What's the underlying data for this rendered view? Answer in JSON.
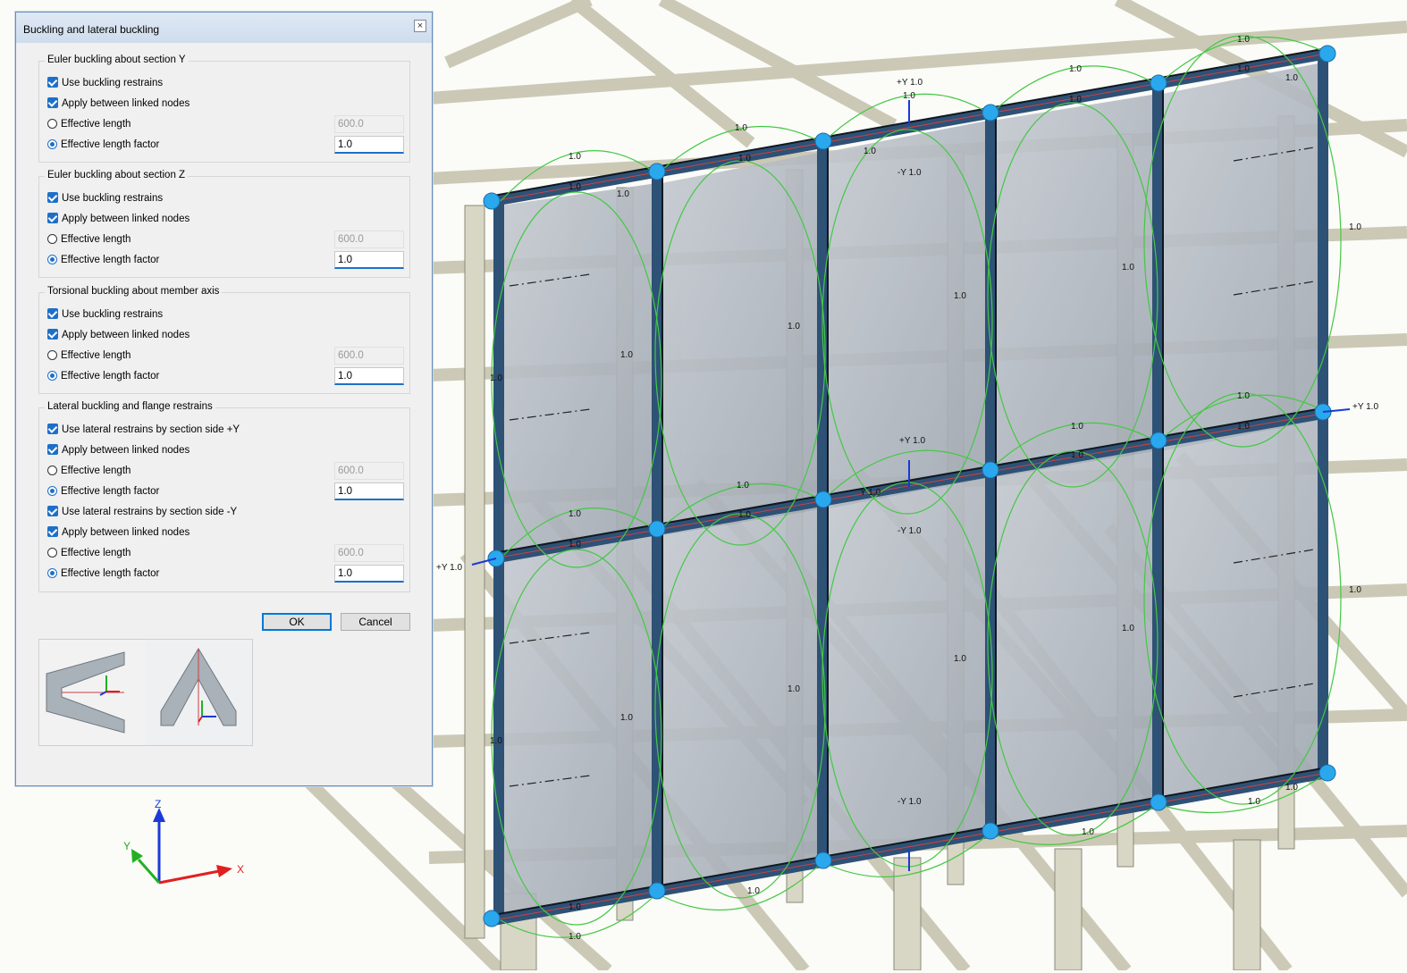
{
  "dialog": {
    "title": "Buckling and lateral buckling",
    "close_label": "×",
    "groups": [
      {
        "title": "Euler buckling about section Y",
        "use_restrains": "Use buckling restrains",
        "apply_linked": "Apply between linked nodes",
        "eff_length_label": "Effective length",
        "eff_length_value": "600.0",
        "eff_factor_label": "Effective length factor",
        "eff_factor_value": "1.0"
      },
      {
        "title": "Euler buckling about section Z",
        "use_restrains": "Use buckling restrains",
        "apply_linked": "Apply between linked nodes",
        "eff_length_label": "Effective length",
        "eff_length_value": "600.0",
        "eff_factor_label": "Effective length factor",
        "eff_factor_value": "1.0"
      },
      {
        "title": "Torsional buckling about member axis",
        "use_restrains": "Use buckling restrains",
        "apply_linked": "Apply between linked nodes",
        "eff_length_label": "Effective length",
        "eff_length_value": "600.0",
        "eff_factor_label": "Effective length factor",
        "eff_factor_value": "1.0"
      }
    ],
    "lateral": {
      "title": "Lateral buckling and flange restrains",
      "plus_y": {
        "use_label": "Use lateral restrains by section side +Y",
        "apply_linked": "Apply between linked nodes",
        "eff_length_label": "Effective length",
        "eff_length_value": "600.0",
        "eff_factor_label": "Effective length factor",
        "eff_factor_value": "1.0"
      },
      "minus_y": {
        "use_label": "Use lateral restrains by section side -Y",
        "apply_linked": "Apply between linked nodes",
        "eff_length_label": "Effective length",
        "eff_length_value": "600.0",
        "eff_factor_label": "Effective length factor",
        "eff_factor_value": "1.0"
      }
    },
    "ok_label": "OK",
    "cancel_label": "Cancel"
  },
  "viewport": {
    "axes": {
      "x": "X",
      "y": "Y",
      "z": "Z"
    },
    "colors": {
      "x_axis": "#e02020",
      "y_axis": "#22b022",
      "z_axis": "#1a3ad8",
      "node": "#2aa8ee",
      "restraint_curve": "#44c844",
      "member": "#2f4f6f"
    },
    "labels": {
      "factor": "1.0",
      "plus_y": "+Y 1.0",
      "minus_y": "-Y 1.0",
      "z_plus_y": "+Y 1.0",
      "y_short": "Y 1.0"
    }
  }
}
